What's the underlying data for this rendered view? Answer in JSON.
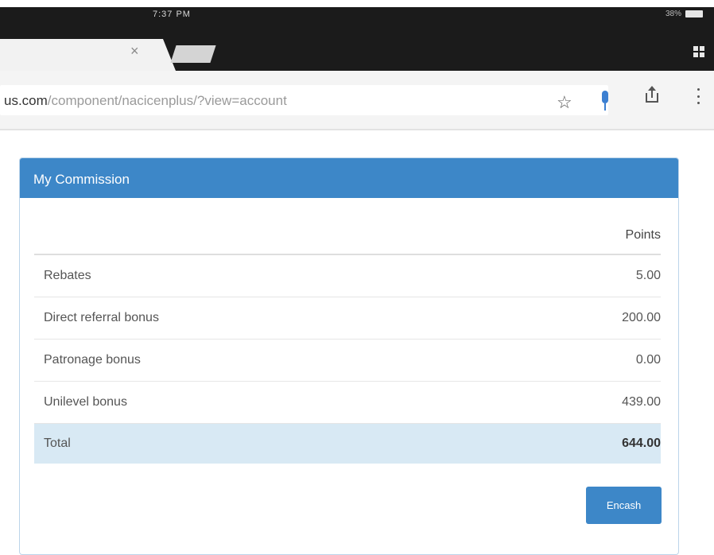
{
  "status_bar": {
    "time": "7:37 PM",
    "battery_percent": "38%"
  },
  "browser": {
    "url_host": "us.com",
    "url_path": "/component/nacicenplus/?view=account"
  },
  "panel": {
    "title": "My Commission",
    "column_header": "Points",
    "rows": [
      {
        "label": "Rebates",
        "value": "5.00"
      },
      {
        "label": "Direct referral bonus",
        "value": "200.00"
      },
      {
        "label": "Patronage bonus",
        "value": "0.00"
      },
      {
        "label": "Unilevel bonus",
        "value": "439.00"
      }
    ],
    "total": {
      "label": "Total",
      "value": "644.00"
    },
    "encash_label": "Encash"
  },
  "colors": {
    "header_blue": "#3d87c8",
    "total_row_bg": "#d8e9f4",
    "chrome_dark": "#1b1b1b"
  },
  "icons": [
    "tab-close-icon",
    "tab-switcher-icon",
    "star-icon",
    "mic-icon",
    "share-icon",
    "menu-icon",
    "battery-icon"
  ]
}
